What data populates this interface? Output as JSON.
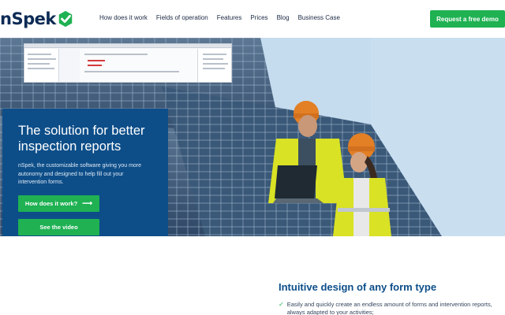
{
  "header": {
    "logo_text": "nSpek",
    "nav": [
      "How does it work",
      "Fields of operation",
      "Features",
      "Prices",
      "Blog",
      "Business Case"
    ],
    "cta_label": "Request a free demo"
  },
  "hero": {
    "title": "The solution for better inspection reports",
    "description": "nSpek, the customizable software giving you more autonomy and designed to help fill out your intervention forms.",
    "btn_how": "How does it work?",
    "btn_video": "See the video"
  },
  "section": {
    "title": "Intuitive design of any form type",
    "feature_1": "Easily and quickly create an endless amount of forms and intervention reports, always adapted to your activities;"
  },
  "colors": {
    "brand_navy": "#0d4e89",
    "brand_green": "#1fb152"
  }
}
